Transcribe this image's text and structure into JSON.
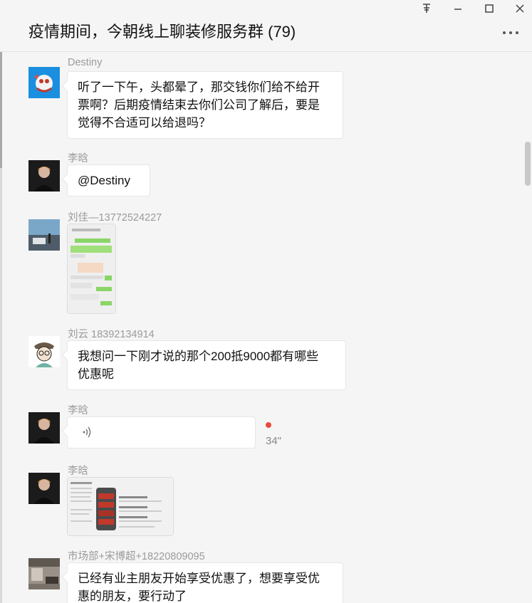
{
  "window": {
    "title": "疫情期间，今朝线上聊装修服务群 (79)",
    "controls": [
      "pin-icon",
      "minimize-icon",
      "maximize-icon",
      "close-icon"
    ],
    "menu_icon": "more-icon"
  },
  "messages": [
    {
      "sender": "Destiny",
      "type": "text",
      "lines": [
        "听了一下午，头都晕了，那交钱你们给不给开",
        "票啊？后期疫情结束去你们公司了解后，要是",
        "觉得不合适可以给退吗？"
      ]
    },
    {
      "sender": "李晗",
      "type": "text",
      "lines": [
        "@Destiny"
      ]
    },
    {
      "sender": "刘佳—13772524227",
      "type": "image",
      "image_desc": "chat-screenshot-thumbnail"
    },
    {
      "sender": "刘云 18392134914",
      "type": "text",
      "lines": [
        "我想问一下刚才说的那个200抵9000都有哪些",
        "优惠呢"
      ]
    },
    {
      "sender": "李晗",
      "type": "voice",
      "duration": "34\"",
      "unread": true
    },
    {
      "sender": "李晗",
      "type": "image",
      "image_desc": "slide-thumbnail"
    },
    {
      "sender": "市场部+宋博超+18220809095",
      "type": "text",
      "lines": [
        "已经有业主朋友开始享受优惠了，想要享受优",
        "惠的朋友，要行动了"
      ]
    }
  ],
  "colors": {
    "background": "#f5f5f5",
    "bubble": "#ffffff",
    "sender_name": "#9b9b9b",
    "unread_dot": "#e74c3c"
  }
}
